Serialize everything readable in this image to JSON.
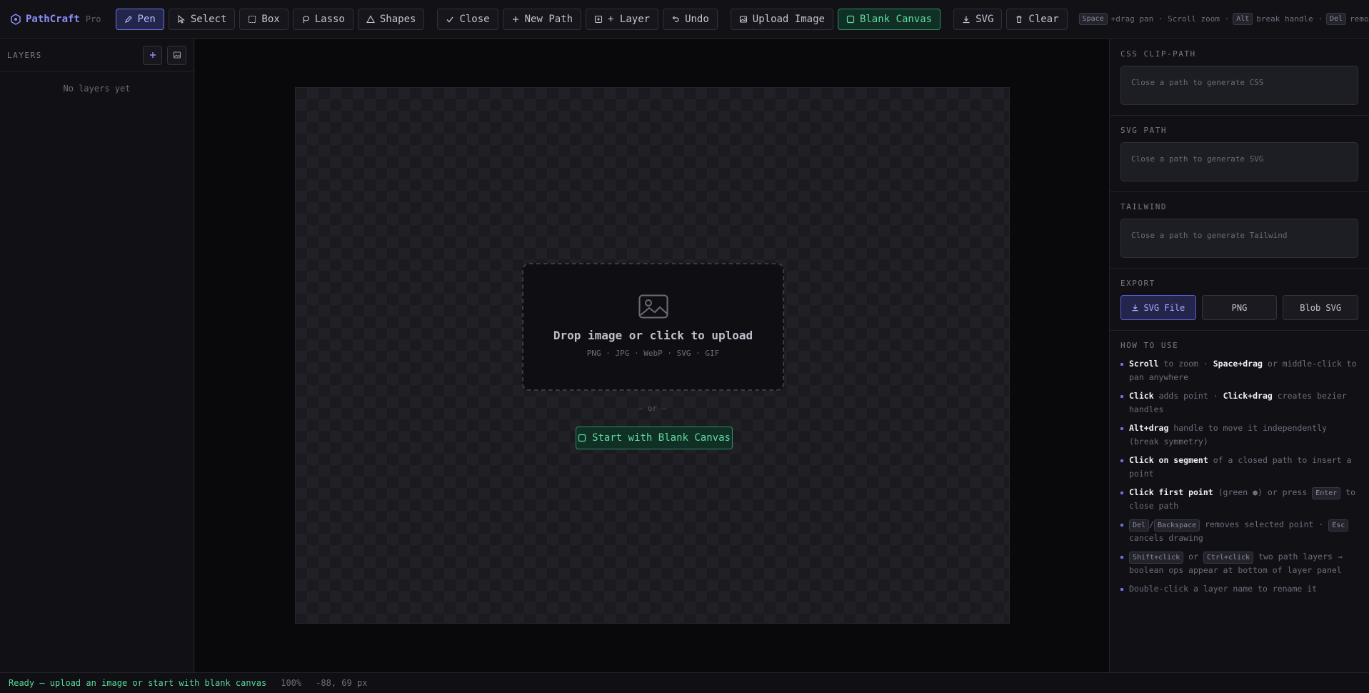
{
  "brand": {
    "name": "PathCraft",
    "tier": "Pro"
  },
  "toolbar": {
    "pen": "Pen",
    "select": "Select",
    "box": "Box",
    "lasso": "Lasso",
    "shapes": "Shapes",
    "close": "Close",
    "new_path": "New Path",
    "add_layer": "+ Layer",
    "undo": "Undo",
    "upload_image": "Upload Image",
    "blank_canvas": "Blank Canvas",
    "svg": "SVG",
    "clear": "Clear"
  },
  "hints": {
    "k1": "Space",
    "t1": "+drag pan · Scroll zoom ·",
    "k2": "Alt",
    "t2": "break handle ·",
    "k3": "Del",
    "t3": "remove p"
  },
  "layers": {
    "title": "LAYERS",
    "empty": "No layers yet"
  },
  "upload": {
    "title": "Drop image or click to upload",
    "formats": "PNG · JPG · WebP · SVG · GIF",
    "or": "— or —",
    "blank_button": "Start with Blank Canvas"
  },
  "right": {
    "css_title": "CSS CLIP-PATH",
    "css_placeholder": "Close a path to generate CSS",
    "svg_title": "SVG PATH",
    "svg_placeholder": "Close a path to generate SVG",
    "tw_title": "TAILWIND",
    "tw_placeholder": "Close a path to generate Tailwind",
    "export_title": "EXPORT",
    "export_svg": "SVG File",
    "export_png": "PNG",
    "export_blob": "Blob SVG",
    "howto_title": "HOW TO USE",
    "tips": {
      "t0": {
        "b1": "Scroll",
        "s1": " to zoom · ",
        "b2": "Space+drag",
        "s2": " or middle-click to pan anywhere"
      },
      "t1": {
        "b1": "Click",
        "s1": " adds point · ",
        "b2": "Click+drag",
        "s2": " creates bezier handles"
      },
      "t2": {
        "b1": "Alt+drag",
        "s1": " handle to move it independently (break symmetry)"
      },
      "t3": {
        "b1": "Click on segment",
        "s1": " of a closed path to insert a point"
      },
      "t4": {
        "b1": "Click first point",
        "s1": " (green ●) or press ",
        "k1": "Enter",
        "s2": " to close path"
      },
      "t5": {
        "k1": "Del",
        "s1": "/",
        "k2": "Backspace",
        "s2": " removes selected point · ",
        "k3": "Esc",
        "s3": " cancels drawing"
      },
      "t6": {
        "k1": "Shift+click",
        "s1": " or ",
        "k2": "Ctrl+click",
        "s2": " two path layers → boolean ops appear at bottom of layer panel"
      },
      "t7": {
        "s1": "Double-click a layer name to rename it"
      }
    }
  },
  "status": {
    "message": "Ready — upload an image or start with blank canvas",
    "zoom": "100%",
    "coords": "-88, 69 px"
  },
  "colors": {
    "accent": "#8b8ff7",
    "green": "#60d9a0",
    "background": "#0d0d11"
  }
}
